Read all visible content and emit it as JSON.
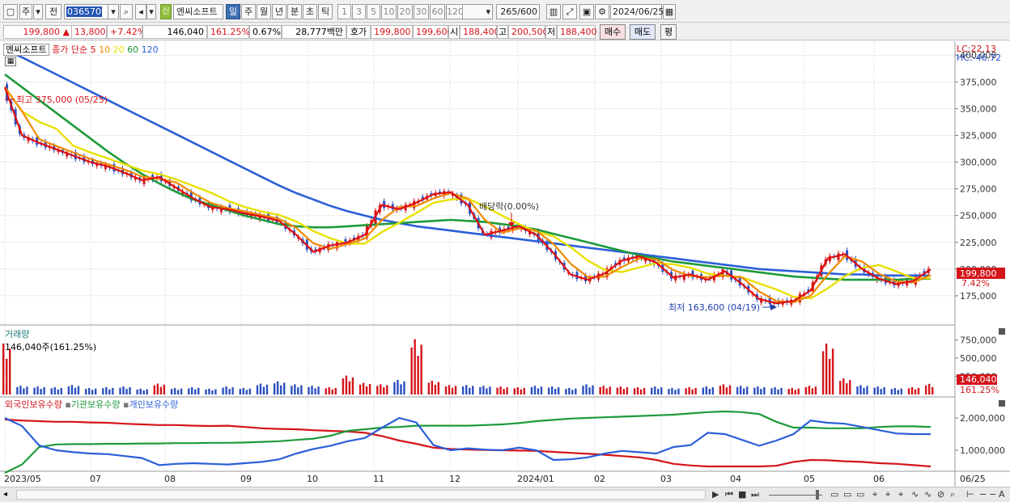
{
  "toolbar": {
    "period_day": "주",
    "prev_label": "전",
    "stock_code": "036570",
    "stock_name": "엔씨소프트",
    "new_badge": "신",
    "interval_tabs": [
      "일",
      "주",
      "월",
      "년",
      "분",
      "초",
      "틱"
    ],
    "active_interval": "일",
    "minute_options": [
      "1",
      "3",
      "5",
      "10",
      "20",
      "30",
      "60",
      "120"
    ],
    "count_value": "265",
    "count_total": "/600",
    "date": "2024/06/25"
  },
  "quote": {
    "price": "199,800",
    "change_arrow": "▲",
    "change": "13,800",
    "change_pct": "+7.42%",
    "volume": "146,040",
    "volume_ratio": "161.25%",
    "turnover_rate": "0.67%",
    "trade_amount": "28,777백만",
    "ask_label": "호가",
    "ask1": "199,800",
    "ask2": "199,600",
    "open_label": "시",
    "open": "188,400",
    "high_label": "고",
    "high": "200,500",
    "low_label": "저",
    "low": "188,400",
    "buy_label": "매수",
    "sell_label": "매도",
    "eval_label": "평"
  },
  "price_panel": {
    "name_tag": "엔씨소프트",
    "legend_prefix": "종가 단순",
    "ma_periods": [
      "5",
      "10",
      "20",
      "60",
      "120"
    ],
    "ma_colors": [
      "#e01010",
      "#f08a00",
      "#e8e000",
      "#1e9a3a",
      "#2b5fd8"
    ],
    "lc_label": "LC:22.13",
    "hc_label": "HC:-46.72",
    "high_annotation": "최고 375,000 (05/25)",
    "low_annotation": "최저 163,600 (04/19)",
    "dividend_annotation": "배당락(0.00%)",
    "y_ticks": [
      "400,000",
      "375,000",
      "350,000",
      "325,000",
      "300,000",
      "275,000",
      "250,000",
      "225,000",
      "200,000",
      "175,000"
    ],
    "price_tag": "199,800",
    "pct_tag": "7.42%"
  },
  "volume_panel": {
    "title": "거래량",
    "current": "146,040주(161.25%)",
    "y_ticks": [
      "750,000",
      "500,000",
      "250,000"
    ],
    "value_tag": "146,040",
    "pct_tag": "161.25%"
  },
  "holding_panel": {
    "legends": [
      "외국인보유수량",
      "기관보유수량",
      "개인보유수량"
    ],
    "legend_colors": [
      "#d4141a",
      "#1e9a3a",
      "#2b5fd8"
    ],
    "y_ticks": [
      "2,000,000",
      "1,000,000"
    ]
  },
  "x_axis": {
    "labels": [
      "2023/05",
      "07",
      "08",
      "09",
      "10",
      "11",
      "12",
      "2024/01",
      "02",
      "03",
      "04",
      "05",
      "06"
    ],
    "end_label": "06/25"
  },
  "chart_data": {
    "type": "line",
    "price_axis_range": [
      150000,
      410000
    ],
    "series": [
      {
        "name": "5",
        "values": [
          370000,
          325000,
          318000,
          312000,
          306000,
          300000,
          296000,
          290000,
          283000,
          286000,
          276000,
          266000,
          258000,
          256000,
          252000,
          249000,
          245000,
          232000,
          216000,
          222000,
          225000,
          232000,
          260000,
          256000,
          262000,
          270000,
          272000,
          260000,
          232000,
          236000,
          240000,
          232000,
          215000,
          195000,
          190000,
          196000,
          208000,
          212000,
          206000,
          192000,
          195000,
          190000,
          198000,
          186000,
          172000,
          168000,
          170000,
          180000,
          210000,
          214000,
          200000,
          191000,
          186000,
          189000,
          199800
        ]
      },
      {
        "name": "120",
        "values": [
          405000,
          398000,
          390000,
          382000,
          374000,
          366000,
          358000,
          350000,
          342000,
          334000,
          326000,
          318000,
          310000,
          302000,
          294000,
          286000,
          278000,
          271000,
          265000,
          259000,
          254000,
          250000,
          246000,
          243000,
          240000,
          238000,
          236000,
          234000,
          232000,
          230000,
          228000,
          226000,
          224000,
          222000,
          220000,
          218000,
          216000,
          214000,
          212000,
          210000,
          208000,
          206000,
          204000,
          202000,
          200000,
          199000,
          198000,
          197000,
          196000,
          195000,
          195000,
          194000,
          194000,
          194000,
          194000
        ]
      },
      {
        "name": "60",
        "values": [
          382000,
          370000,
          358000,
          346000,
          334000,
          322000,
          310000,
          299000,
          289000,
          280000,
          272000,
          265000,
          260000,
          255000,
          250000,
          246000,
          242000,
          240000,
          239000,
          239000,
          240000,
          241000,
          242000,
          243000,
          244000,
          245000,
          246000,
          245000,
          244000,
          242000,
          240000,
          237000,
          233000,
          229000,
          225000,
          221000,
          217000,
          213000,
          210000,
          207000,
          205000,
          203000,
          201000,
          199000,
          197000,
          195000,
          193000,
          192000,
          191000,
          190000,
          190000,
          190000,
          190000,
          191000,
          191000
        ]
      },
      {
        "name": "거래량",
        "values": [
          700000,
          120000,
          110000,
          100000,
          130000,
          90000,
          100000,
          110000,
          80000,
          150000,
          90000,
          100000,
          80000,
          110000,
          90000,
          150000,
          180000,
          140000,
          120000,
          100000,
          260000,
          160000,
          140000,
          200000,
          760000,
          190000,
          130000,
          130000,
          120000,
          110000,
          100000,
          120000,
          110000,
          90000,
          140000,
          120000,
          110000,
          100000,
          110000,
          90000,
          100000,
          110000,
          140000,
          120000,
          110000,
          100000,
          90000,
          120000,
          700000,
          220000,
          130000,
          110000,
          90000,
          100000,
          146040
        ]
      },
      {
        "name": "외국인보유수량",
        "values": [
          1950000,
          1920000,
          1900000,
          1880000,
          1880000,
          1860000,
          1850000,
          1820000,
          1800000,
          1780000,
          1780000,
          1760000,
          1750000,
          1760000,
          1720000,
          1680000,
          1660000,
          1650000,
          1620000,
          1600000,
          1580000,
          1540000,
          1440000,
          1300000,
          1200000,
          1080000,
          1040000,
          1020000,
          1010000,
          1000000,
          990000,
          980000,
          950000,
          920000,
          890000,
          860000,
          820000,
          780000,
          700000,
          580000,
          530000,
          500000,
          500000,
          500000,
          500000,
          520000,
          640000,
          700000,
          690000,
          660000,
          640000,
          600000,
          580000,
          540000,
          500000
        ]
      },
      {
        "name": "기관보유수량",
        "values": [
          300000,
          560000,
          1100000,
          1180000,
          1190000,
          1190000,
          1200000,
          1200000,
          1210000,
          1210000,
          1220000,
          1220000,
          1230000,
          1230000,
          1240000,
          1260000,
          1280000,
          1320000,
          1360000,
          1450000,
          1600000,
          1650000,
          1700000,
          1720000,
          1760000,
          1760000,
          1760000,
          1760000,
          1780000,
          1800000,
          1840000,
          1900000,
          1940000,
          1980000,
          2000000,
          2020000,
          2040000,
          2060000,
          2080000,
          2100000,
          2140000,
          2180000,
          2200000,
          2180000,
          2120000,
          1880000,
          1700000,
          1700000,
          1680000,
          1680000,
          1680000,
          1720000,
          1740000,
          1740000,
          1720000
        ]
      },
      {
        "name": "개인보유수량",
        "values": [
          2000000,
          1750000,
          1150000,
          1000000,
          940000,
          900000,
          880000,
          820000,
          760000,
          540000,
          580000,
          600000,
          580000,
          560000,
          600000,
          640000,
          720000,
          900000,
          1040000,
          1140000,
          1280000,
          1380000,
          1700000,
          2000000,
          1860000,
          1160000,
          1000000,
          1060000,
          1020000,
          1000000,
          1080000,
          1000000,
          700000,
          720000,
          780000,
          900000,
          980000,
          940000,
          900000,
          1100000,
          1160000,
          1540000,
          1500000,
          1320000,
          1140000,
          1300000,
          1500000,
          1920000,
          1850000,
          1820000,
          1720000,
          1620000,
          1520000,
          1500000,
          1500000
        ]
      }
    ]
  }
}
